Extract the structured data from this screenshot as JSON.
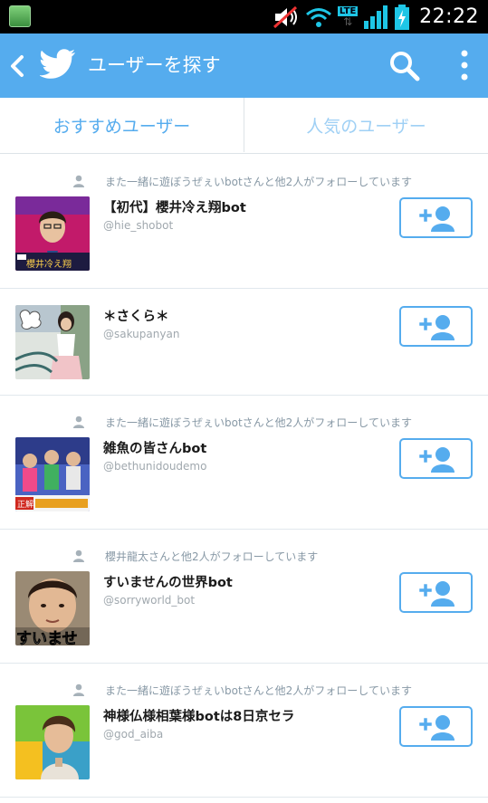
{
  "status_bar": {
    "time": "22:22",
    "network": "LTE",
    "icons": [
      "app-icon",
      "mute-icon",
      "wifi-icon",
      "signal-icon",
      "battery-charging-icon"
    ]
  },
  "header": {
    "title": "ユーザーを探す",
    "icons": [
      "back-arrow-icon",
      "twitter-bird-icon",
      "search-icon",
      "overflow-menu-icon"
    ],
    "color": "#55acee"
  },
  "tabs": [
    {
      "label": "おすすめユーザー",
      "selected": true
    },
    {
      "label": "人気のユーザー",
      "selected": false
    }
  ],
  "users": [
    {
      "social": "また一緒に遊ぼうぜぇいbotさんと他2人がフォローしています",
      "name": "【初代】櫻井冷え翔bot",
      "handle": "@hie_shobot"
    },
    {
      "social": "",
      "name": "＊さくら＊",
      "handle": "@sakupanyan"
    },
    {
      "social": "また一緒に遊ぼうぜぇいbotさんと他2人がフォローしています",
      "name": "雑魚の皆さんbot",
      "handle": "@bethunidoudemo"
    },
    {
      "social": "櫻井龍太さんと他2人がフォローしています",
      "name": "すいませんの世界bot",
      "handle": "@sorryworld_bot"
    },
    {
      "social": "また一緒に遊ぼうぜぇいbotさんと他2人がフォローしています",
      "name": "神様仏様相葉様botは8日京セラ",
      "handle": "@god_aiba"
    }
  ],
  "avatar_captions": [
    "櫻井冷え翔",
    "",
    "正解",
    "すいませ",
    ""
  ],
  "colors": {
    "accent": "#55acee",
    "accent_light": "#9fd0f5",
    "secondary_text": "#8899a6"
  }
}
